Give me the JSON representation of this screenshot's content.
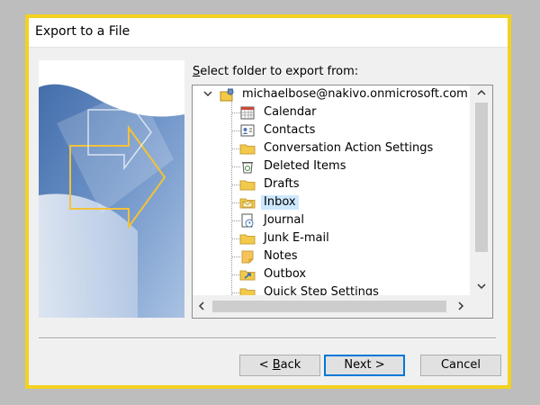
{
  "window": {
    "title": "Export to a File"
  },
  "prompt": {
    "prefix": "",
    "underlined": "S",
    "rest": "elect folder to export from:"
  },
  "tree": {
    "root": {
      "label": "michaelbose@nakivo.onmicrosoft.com",
      "icon": "account-folders-icon"
    },
    "items": [
      {
        "label": "Calendar",
        "icon": "calendar-icon"
      },
      {
        "label": "Contacts",
        "icon": "contacts-icon"
      },
      {
        "label": "Conversation Action Settings",
        "icon": "folder-icon"
      },
      {
        "label": "Deleted Items",
        "icon": "deleted-items-icon"
      },
      {
        "label": "Drafts",
        "icon": "folder-icon"
      },
      {
        "label": "Inbox",
        "icon": "inbox-icon",
        "selected": true
      },
      {
        "label": "Journal",
        "icon": "journal-icon"
      },
      {
        "label": "Junk E-mail",
        "icon": "folder-icon"
      },
      {
        "label": "Notes",
        "icon": "notes-icon"
      },
      {
        "label": "Outbox",
        "icon": "outbox-icon"
      },
      {
        "label": "Quick Step Settings",
        "icon": "folder-icon"
      }
    ]
  },
  "buttons": {
    "back": {
      "mnemonic": "B",
      "rest": "ack",
      "prefix": "< "
    },
    "next": {
      "label": "Next >"
    },
    "cancel": {
      "label": "Cancel"
    }
  },
  "colors": {
    "highlight_border": "#f3d21f",
    "selection": "#cde8ff",
    "folder": "#f3c94a"
  }
}
